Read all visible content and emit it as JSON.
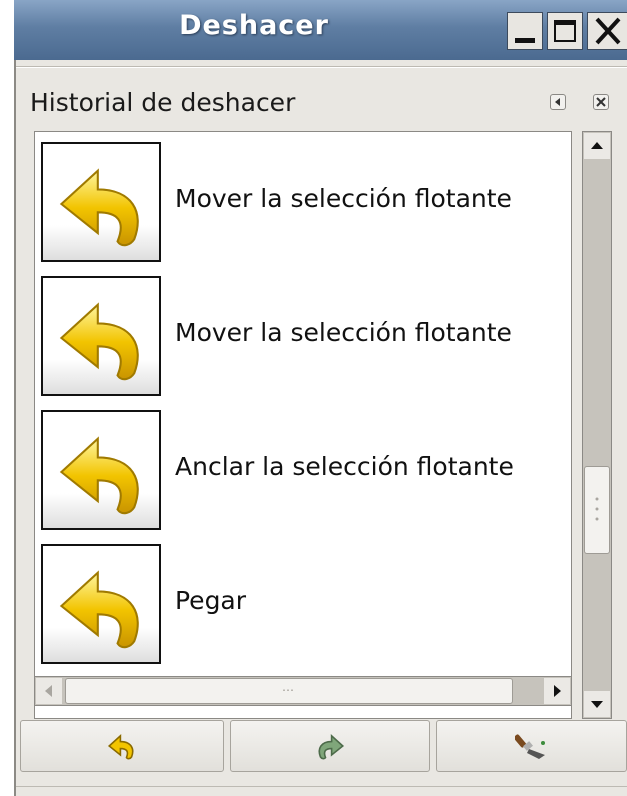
{
  "window": {
    "title": "Deshacer"
  },
  "dock": {
    "title": "Historial de deshacer"
  },
  "history": {
    "items": [
      {
        "label": "Mover la selección flotante",
        "icon": "undo-arrow-icon"
      },
      {
        "label": "Mover la selección flotante",
        "icon": "undo-arrow-icon"
      },
      {
        "label": "Anclar la selección flotante",
        "icon": "undo-arrow-icon"
      },
      {
        "label": "Pegar",
        "icon": "undo-arrow-icon"
      }
    ]
  },
  "hscroll": {
    "grip": "⋯"
  },
  "buttons": {
    "undo_icon": "undo-icon",
    "redo_icon": "redo-icon",
    "clear_icon": "clear-history-icon"
  },
  "colors": {
    "titlebar": "#5f7ea3",
    "arrow_yellow": "#f2c400",
    "redo_green": "#7fa67a"
  }
}
